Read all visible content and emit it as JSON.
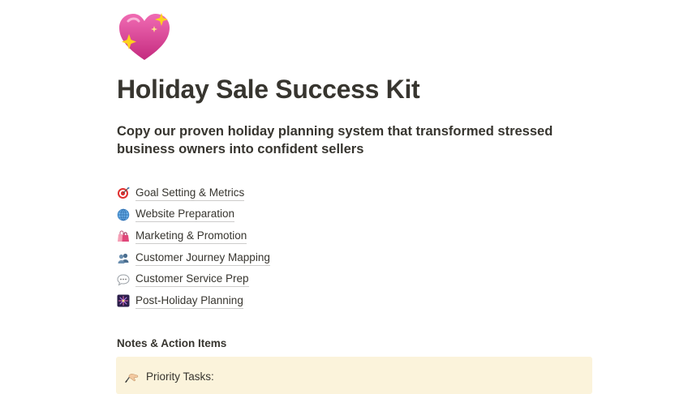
{
  "page": {
    "icon": "sparkling-heart-icon",
    "title": "Holiday Sale Success Kit",
    "subtitle": "Copy our proven holiday planning system that transformed stressed business owners into confident sellers"
  },
  "links": [
    {
      "icon": "direct-hit-target-icon",
      "label": "Goal Setting & Metrics"
    },
    {
      "icon": "globe-meridians-icon",
      "label": "Website Preparation"
    },
    {
      "icon": "shopping-bags-icon",
      "label": "Marketing & Promotion"
    },
    {
      "icon": "busts-in-silhouette-icon",
      "label": "Customer Journey Mapping"
    },
    {
      "icon": "speech-balloon-icon",
      "label": "Customer Service Prep"
    },
    {
      "icon": "fireworks-icon",
      "label": "Post-Holiday Planning"
    }
  ],
  "notes": {
    "heading": "Notes & Action Items",
    "callout": {
      "icon": "writing-hand-icon",
      "text": "Priority Tasks:",
      "background": "#fbf3db"
    }
  },
  "colors": {
    "text": "#37352f",
    "background": "#ffffff",
    "heart": "#e83e8c"
  }
}
